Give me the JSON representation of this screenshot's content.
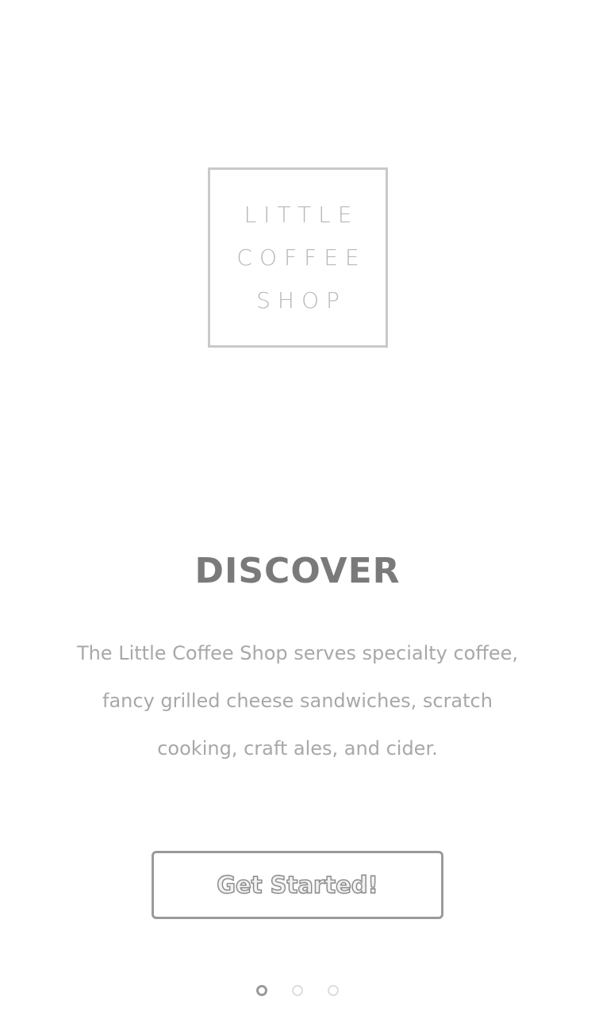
{
  "logo": {
    "lines": [
      "LITTLE",
      "COFFEE",
      "SHOP"
    ]
  },
  "onboarding": {
    "heading": "DISCOVER",
    "description": "The Little Coffee Shop serves specialty coffee, fancy grilled cheese sandwiches, scratch cooking, craft ales, and cider.",
    "cta_label": "Get Started!"
  },
  "pagination": {
    "total": 3,
    "active_index": 0
  },
  "colors": {
    "background": "#ffffff",
    "logo_border": "#c9c9c9",
    "heading": "#7a7a7a",
    "body_text": "#a8a8a8",
    "button_border": "#9a9a9a"
  }
}
